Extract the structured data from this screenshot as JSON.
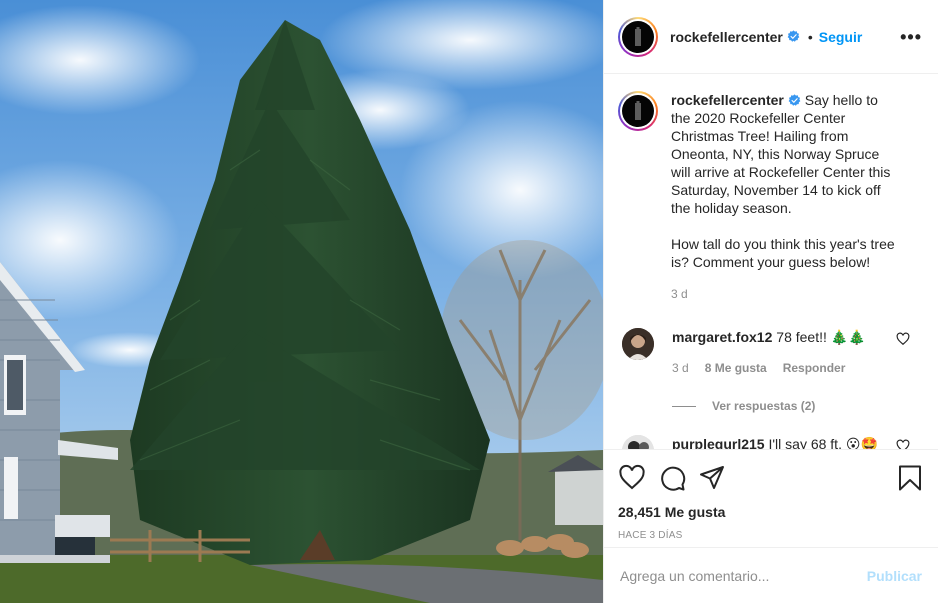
{
  "post": {
    "username": "rockefellercenter",
    "dot": "•",
    "follow_label": "Seguir",
    "more_label": "•••",
    "caption_p1": "Say hello to the 2020 Rockefeller Center Christmas Tree! Hailing from Oneonta, NY, this Norway Spruce will arrive at Rockefeller Center this Saturday, November 14 to kick off the holiday season.",
    "caption_p2": "How tall do you think this year's tree is? Comment your guess below!",
    "caption_time": "3 d"
  },
  "comments": [
    {
      "username": "margaret.fox12",
      "text": "78 feet!!",
      "emoji": "🎄🎄",
      "time": "3 d",
      "likes": "8 Me gusta",
      "reply_label": "Responder",
      "view_replies": "Ver respuestas (2)"
    },
    {
      "username": "purplegurl215",
      "text": "I'll say 68 ft.",
      "emoji": "😮🤩"
    }
  ],
  "footer": {
    "likes": "28,451 Me gusta",
    "date": "HACE 3 DÍAS",
    "comment_placeholder": "Agrega un comentario...",
    "publish_label": "Publicar"
  },
  "icons": {
    "like": "heart-icon",
    "comment": "comment-icon",
    "share": "paper-plane-icon",
    "save": "bookmark-icon",
    "verified": "verified-badge-icon"
  },
  "colors": {
    "accent": "#0095f6",
    "publish_disabled": "#b2dffc",
    "verified": "#3897f0",
    "secondary_text": "#8e8e8e"
  }
}
